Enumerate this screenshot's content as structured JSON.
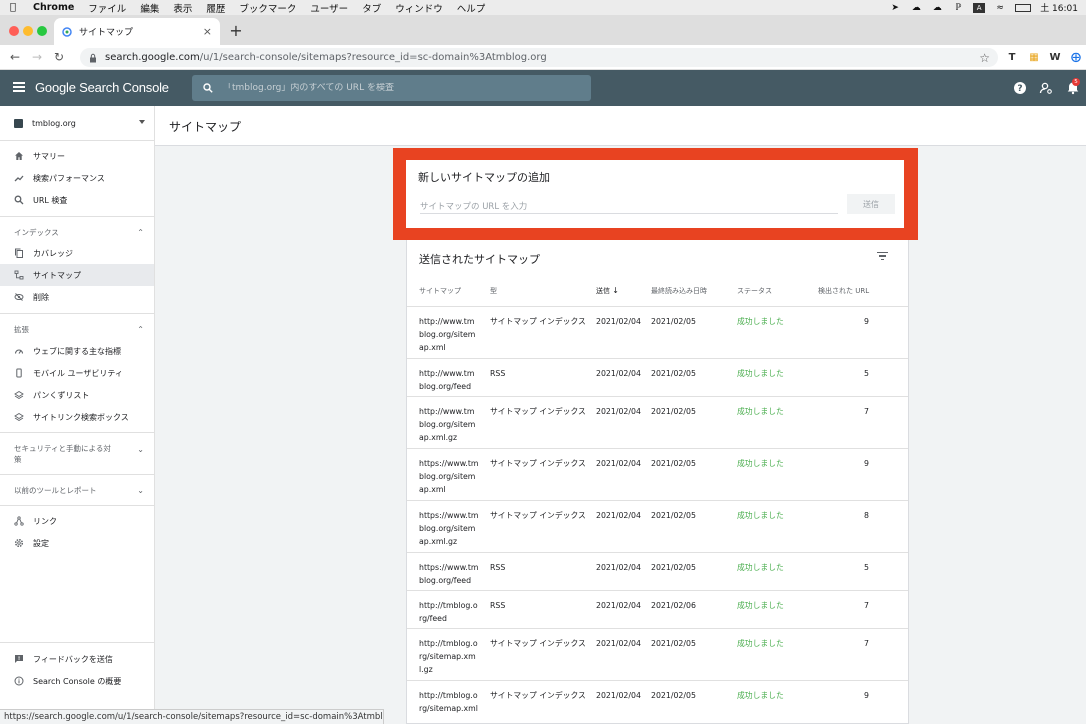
{
  "menubar": {
    "items": [
      "Chrome",
      "ファイル",
      "編集",
      "表示",
      "履歴",
      "ブックマーク",
      "ユーザー",
      "タブ",
      "ウィンドウ",
      "ヘルプ"
    ],
    "clock": "土 16:01"
  },
  "browser": {
    "tab_title": "サイトマップ",
    "new_tab": "+",
    "url_host": "search.google.com",
    "url_path": "/u/1/search-console/sitemaps?resource_id=sc-domain%3Atmblog.org",
    "ext_t": "T",
    "ext_w": "W",
    "status_url": "https://search.google.com/u/1/search-console/sitemaps?resource_id=sc-domain%3Atmblog.org"
  },
  "header": {
    "brand": "Google Search Console",
    "search_placeholder": "「tmblog.org」内のすべての URL を検査",
    "notifications_count": "5"
  },
  "sidebar": {
    "property": "tmblog.org",
    "top_items": [
      "サマリー",
      "検索パフォーマンス",
      "URL 検査"
    ],
    "index_section": "インデックス",
    "index_items": [
      "カバレッジ",
      "サイトマップ",
      "削除"
    ],
    "ext_section": "拡張",
    "ext_items": [
      "ウェブに関する主な指標",
      "モバイル ユーザビリティ",
      "パンくずリスト",
      "サイトリンク検索ボックス"
    ],
    "security_section": "セキュリティと手動による対策",
    "legacy_section": "以前のツールとレポート",
    "misc_items": [
      "リンク",
      "設定"
    ],
    "footer_items": [
      "フィードバックを送信",
      "Search Console の概要"
    ]
  },
  "page": {
    "title": "サイトマップ",
    "add_title": "新しいサイトマップの追加",
    "add_placeholder": "サイトマップの URL を入力",
    "send": "送信",
    "list_title": "送信されたサイトマップ"
  },
  "table": {
    "headers": [
      "サイトマップ",
      "型",
      "送信",
      "最終読み込み日時",
      "ステータス",
      "検出された URL"
    ],
    "rows": [
      {
        "url": "http://www.tmblog.org/sitemap.xml",
        "type": "サイトマップ インデックス",
        "sent": "2021/02/04",
        "read": "2021/02/05",
        "status": "成功しました",
        "count": "9"
      },
      {
        "url": "http://www.tmblog.org/feed",
        "type": "RSS",
        "sent": "2021/02/04",
        "read": "2021/02/05",
        "status": "成功しました",
        "count": "5"
      },
      {
        "url": "http://www.tmblog.org/sitemap.xml.gz",
        "type": "サイトマップ インデックス",
        "sent": "2021/02/04",
        "read": "2021/02/05",
        "status": "成功しました",
        "count": "7"
      },
      {
        "url": "https://www.tmblog.org/sitemap.xml",
        "type": "サイトマップ インデックス",
        "sent": "2021/02/04",
        "read": "2021/02/05",
        "status": "成功しました",
        "count": "9"
      },
      {
        "url": "https://www.tmblog.org/sitemap.xml.gz",
        "type": "サイトマップ インデックス",
        "sent": "2021/02/04",
        "read": "2021/02/05",
        "status": "成功しました",
        "count": "8"
      },
      {
        "url": "https://www.tmblog.org/feed",
        "type": "RSS",
        "sent": "2021/02/04",
        "read": "2021/02/05",
        "status": "成功しました",
        "count": "5"
      },
      {
        "url": "http://tmblog.org/feed",
        "type": "RSS",
        "sent": "2021/02/04",
        "read": "2021/02/06",
        "status": "成功しました",
        "count": "7"
      },
      {
        "url": "http://tmblog.org/sitemap.xml.gz",
        "type": "サイトマップ インデックス",
        "sent": "2021/02/04",
        "read": "2021/02/05",
        "status": "成功しました",
        "count": "7"
      },
      {
        "url": "http://tmblog.org/sitemap.xml",
        "type": "サイトマップ インデックス",
        "sent": "2021/02/04",
        "read": "2021/02/05",
        "status": "成功しました",
        "count": "9"
      }
    ]
  },
  "colors": {
    "appbar": "#455a64",
    "highlight": "#e84321",
    "success": "#4caf50"
  }
}
